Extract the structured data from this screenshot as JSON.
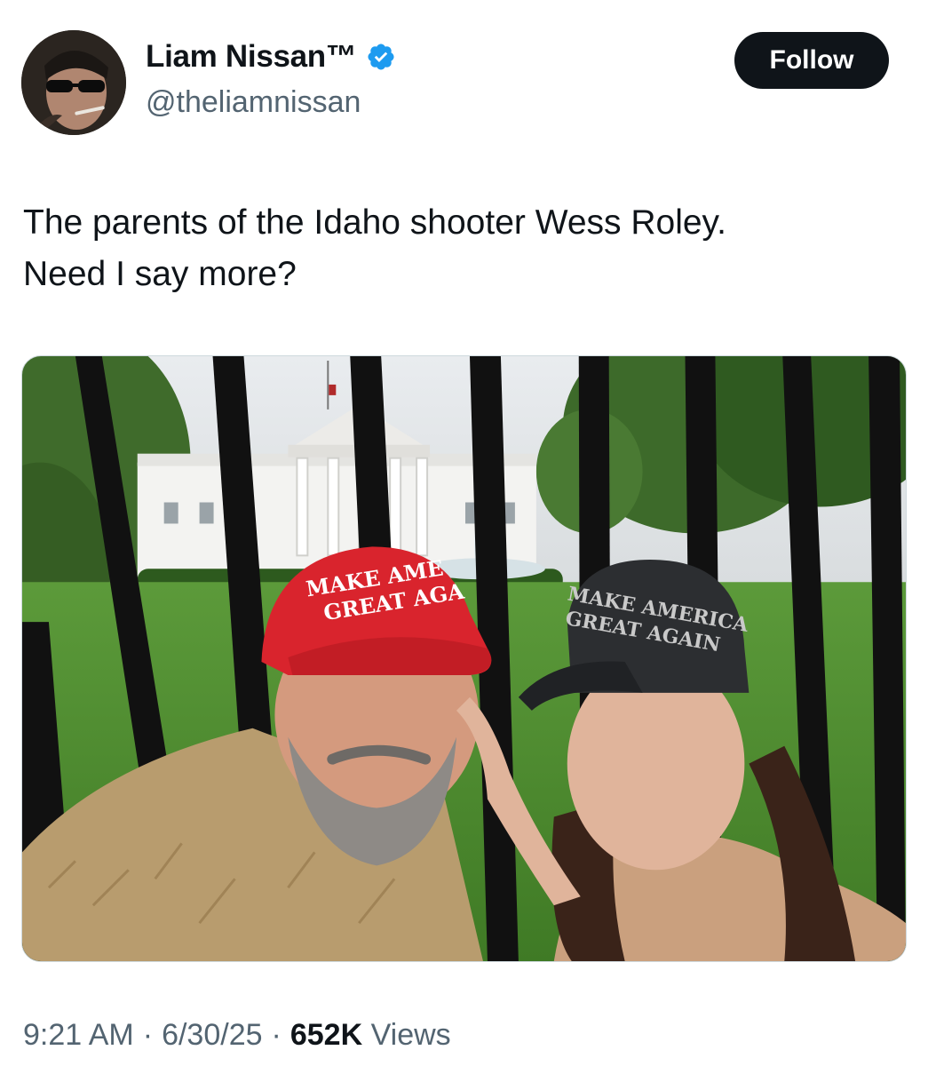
{
  "author": {
    "display_name": "Liam Nissan™",
    "handle": "@theliamnissan",
    "verified": true,
    "avatar_icon": "avatar-photo"
  },
  "actions": {
    "follow_label": "Follow"
  },
  "tweet": {
    "text_line1": "The parents of the Idaho shooter Wess Roley.",
    "text_line2": "Need I say more?"
  },
  "media": {
    "red_hat_line1": "MAKE AME",
    "red_hat_line2": "GREAT AGA",
    "black_hat_line1": "MAKE AMERICA",
    "black_hat_line2": "GREAT AGAIN"
  },
  "footer": {
    "time": "9:21 AM",
    "date": "6/30/25",
    "views_count": "652K",
    "views_label": "Views"
  },
  "colors": {
    "follow_bg": "#0f1419",
    "verified": "#1d9bf0",
    "secondary_text": "#536471"
  }
}
